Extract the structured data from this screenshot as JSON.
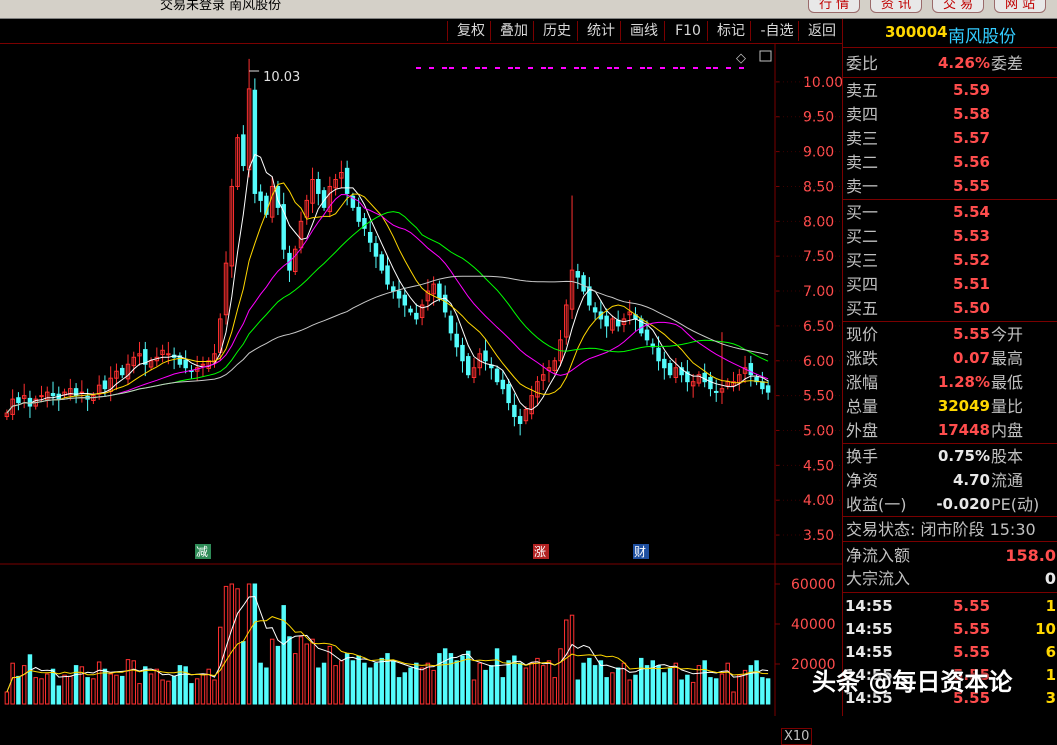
{
  "window": {
    "title": "交易未登录  南风股份",
    "menu": [
      "行 情",
      "资 讯",
      "交 易",
      "网 站"
    ]
  },
  "toolbar": {
    "buttons": [
      "复权",
      "叠加",
      "历史",
      "统计",
      "画线",
      "F10",
      "标记",
      "-自选",
      "返回"
    ]
  },
  "chart": {
    "peak_label": "10.03",
    "price_ticks": [
      "10.00",
      "9.50",
      "9.00",
      "8.50",
      "8.00",
      "7.50",
      "7.00",
      "6.50",
      "6.00",
      "5.50",
      "5.00",
      "4.50",
      "4.00",
      "3.50"
    ],
    "volume_ticks": [
      "60000",
      "40000",
      "20000"
    ],
    "volume_unit": "X10",
    "markers": [
      {
        "label": "减",
        "color": "#2e8b57"
      },
      {
        "label": "涨",
        "color": "#b22222"
      },
      {
        "label": "财",
        "color": "#1e4fa0"
      }
    ],
    "ma_colors": {
      "ma5": "#ffffff",
      "ma10": "#ffd700",
      "ma20": "#ff00ff",
      "ma30": "#00ff00",
      "ma60": "#c8c8c8"
    },
    "up_color": "#ff3030",
    "down_color": "#54fcfc"
  },
  "chart_data": {
    "type": "candlestick",
    "ylim": [
      3.3,
      10.4
    ],
    "closes": [
      5.25,
      5.45,
      5.4,
      5.5,
      5.35,
      5.45,
      5.5,
      5.55,
      5.5,
      5.45,
      5.55,
      5.6,
      5.5,
      5.55,
      5.45,
      5.5,
      5.65,
      5.6,
      5.75,
      5.85,
      5.8,
      5.95,
      6.05,
      6.1,
      5.95,
      6.0,
      6.05,
      6.15,
      6.1,
      6.05,
      5.95,
      5.9,
      5.85,
      5.9,
      5.95,
      6.0,
      6.1,
      6.6,
      7.4,
      8.5,
      9.2,
      8.8,
      9.9,
      8.4,
      8.3,
      8.1,
      8.5,
      8.2,
      7.6,
      7.3,
      7.6,
      8.0,
      8.3,
      8.6,
      8.4,
      8.2,
      8.5,
      8.6,
      8.7,
      8.4,
      8.2,
      8.0,
      7.9,
      7.7,
      7.5,
      7.3,
      7.1,
      7.0,
      6.9,
      6.8,
      6.7,
      6.6,
      6.8,
      7.0,
      7.1,
      6.9,
      6.7,
      6.4,
      6.2,
      6.0,
      5.8,
      5.9,
      6.1,
      6.0,
      5.9,
      5.7,
      5.6,
      5.4,
      5.2,
      5.1,
      5.3,
      5.5,
      5.7,
      5.8,
      5.9,
      6.0,
      6.3,
      6.8,
      7.3,
      7.2,
      7.0,
      6.8,
      6.7,
      6.6,
      6.5,
      6.6,
      6.5,
      6.6,
      6.7,
      6.6,
      6.4,
      6.3,
      6.2,
      6.0,
      5.9,
      5.8,
      5.9,
      5.8,
      5.7,
      5.7,
      5.8,
      5.7,
      5.6,
      5.55,
      5.6,
      5.7,
      5.7,
      5.8,
      5.9,
      5.8,
      5.7,
      5.6,
      5.55
    ],
    "volume_ylim": [
      0,
      65000
    ],
    "price_label": "10.03"
  },
  "quote": {
    "code": "300004",
    "name": "南风股份",
    "weibi": {
      "label": "委比",
      "value": "4.26%",
      "label2": "委差"
    },
    "asks": [
      {
        "label": "卖五",
        "price": "5.59"
      },
      {
        "label": "卖四",
        "price": "5.58"
      },
      {
        "label": "卖三",
        "price": "5.57"
      },
      {
        "label": "卖二",
        "price": "5.56"
      },
      {
        "label": "卖一",
        "price": "5.55"
      }
    ],
    "bids": [
      {
        "label": "买一",
        "price": "5.54"
      },
      {
        "label": "买二",
        "price": "5.53"
      },
      {
        "label": "买三",
        "price": "5.52"
      },
      {
        "label": "买四",
        "price": "5.51"
      },
      {
        "label": "买五",
        "price": "5.50"
      }
    ],
    "stats": [
      {
        "label": "现价",
        "value": "5.55",
        "label2": "今开",
        "color": "red"
      },
      {
        "label": "涨跌",
        "value": "0.07",
        "label2": "最高",
        "color": "red"
      },
      {
        "label": "涨幅",
        "value": "1.28%",
        "label2": "最低",
        "color": "red"
      },
      {
        "label": "总量",
        "value": "32049",
        "label2": "量比",
        "color": "yellow"
      },
      {
        "label": "外盘",
        "value": "17448",
        "label2": "内盘",
        "color": "red"
      }
    ],
    "fundamentals": [
      {
        "label": "换手",
        "value": "0.75%",
        "label2": "股本"
      },
      {
        "label": "净资",
        "value": "4.70",
        "label2": "流通"
      },
      {
        "label": "收益(一)",
        "value": "-0.020",
        "label2": "PE(动)"
      }
    ],
    "status": "交易状态: 闭市阶段  15:30",
    "netflow": {
      "label": "净流入额",
      "value": "158.0"
    },
    "bigflow": {
      "label": "大宗流入",
      "value": "0"
    },
    "ticks": [
      {
        "time": "14:55",
        "price": "5.55",
        "vol": "1"
      },
      {
        "time": "14:55",
        "price": "5.55",
        "vol": "10"
      },
      {
        "time": "14:55",
        "price": "5.55",
        "vol": "6"
      },
      {
        "time": "14:55",
        "price": "5.55",
        "vol": "1"
      },
      {
        "time": "14:55",
        "price": "5.55",
        "vol": "3"
      }
    ]
  },
  "watermark": "头条 @每日资本论"
}
